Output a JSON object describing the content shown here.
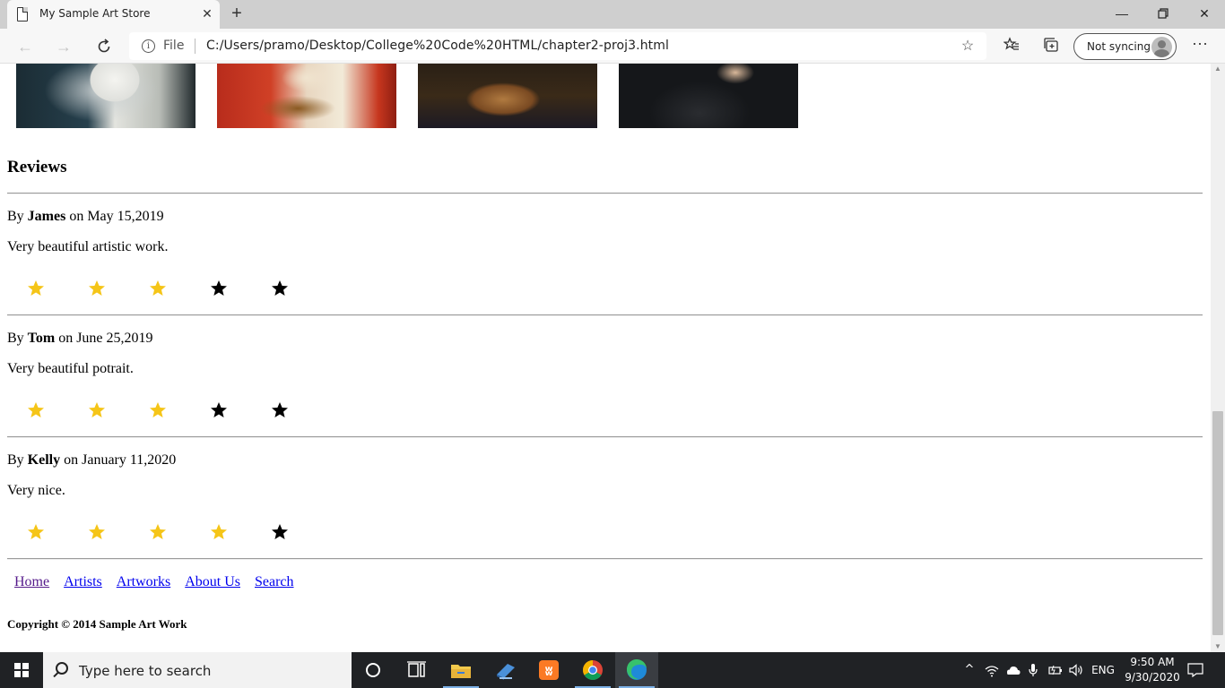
{
  "browser": {
    "tab_title": "My Sample Art Store",
    "address_scheme_label": "File",
    "url": "C:/Users/pramo/Desktop/College%20Code%20HTML/chapter2-proj3.html",
    "sync_label": "Not syncing"
  },
  "page": {
    "reviews_heading": "Reviews",
    "reviews": [
      {
        "by_prefix": "By ",
        "author": "James",
        "date_prefix": " on ",
        "date": "May 15,2019",
        "text": "Very beautiful artistic work.",
        "rating": 3,
        "max_rating": 5
      },
      {
        "by_prefix": "By ",
        "author": "Tom",
        "date_prefix": " on ",
        "date": "June 25,2019",
        "text": "Very beautiful potrait.",
        "rating": 3,
        "max_rating": 5
      },
      {
        "by_prefix": "By ",
        "author": "Kelly",
        "date_prefix": " on ",
        "date": "January 11,2020",
        "text": "Very nice.",
        "rating": 4,
        "max_rating": 5
      }
    ],
    "star_colors": {
      "filled": "#f5c518",
      "empty": "#000000"
    },
    "footer_nav": [
      "Home",
      "Artists",
      "Artworks",
      "About Us",
      "Search"
    ],
    "copyright": "Copyright © 2014 Sample Art Work"
  },
  "taskbar": {
    "search_placeholder": "Type here to search",
    "language": "ENG",
    "time": "9:50 AM",
    "date": "9/30/2020"
  },
  "icons": {
    "tab": "page-icon",
    "browser_toolbar": [
      "back-icon",
      "forward-icon",
      "refresh-icon",
      "info-icon",
      "favorite-star-icon",
      "favorites-icon",
      "collections-icon",
      "more-icon"
    ],
    "taskbar_apps": [
      "cortana-icon",
      "task-view-icon",
      "file-explorer-icon",
      "app-icon",
      "xampp-icon",
      "chrome-icon",
      "edge-icon"
    ]
  }
}
